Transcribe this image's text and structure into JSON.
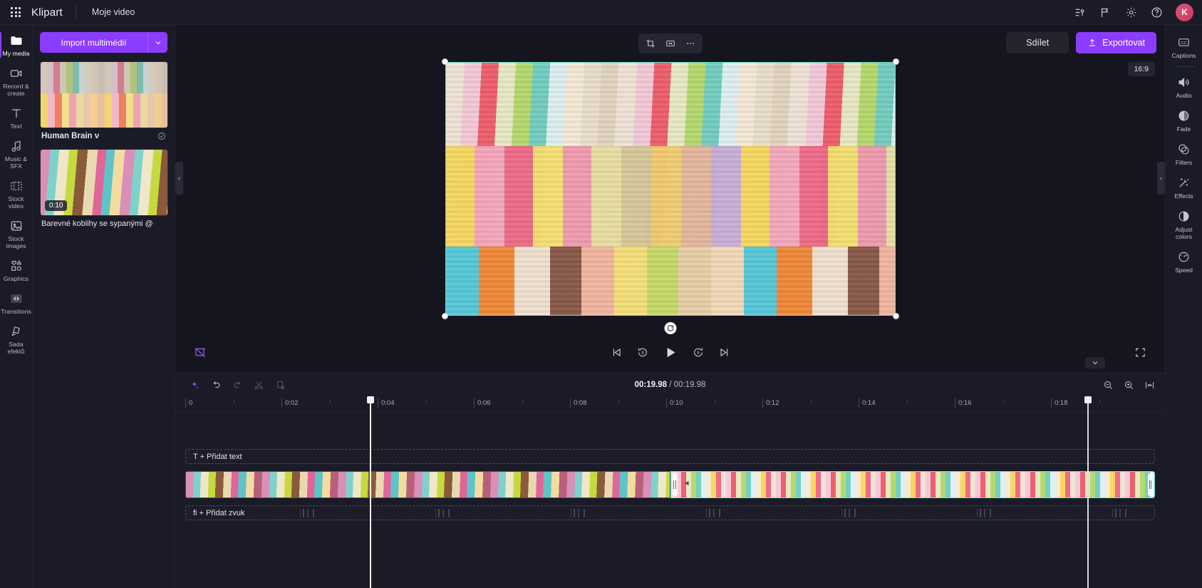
{
  "app": {
    "brand": "Klipart",
    "project_title": "Moje video",
    "accent": "#8b3dff",
    "selection_color": "#5fe3c8",
    "avatar_initial": "K"
  },
  "topbar": {
    "icons": [
      {
        "name": "versions-icon",
        "glyph": "versions"
      },
      {
        "name": "flag-icon",
        "glyph": "flag"
      },
      {
        "name": "settings-icon",
        "glyph": "gear"
      },
      {
        "name": "help-icon",
        "glyph": "question"
      }
    ]
  },
  "left_rail": {
    "items": [
      {
        "label": "My media",
        "icon": "folder-icon",
        "active": true
      },
      {
        "label": "Record & create",
        "icon": "camera-icon",
        "active": false
      },
      {
        "label": "Text",
        "icon": "text-icon",
        "active": false
      },
      {
        "label": "Music & SFX",
        "icon": "music-icon",
        "active": false
      },
      {
        "label": "Stock video",
        "icon": "film-icon",
        "active": false
      },
      {
        "label": "Stock images",
        "icon": "image-icon",
        "active": false
      },
      {
        "label": "Graphics",
        "icon": "shapes-icon",
        "active": false
      },
      {
        "label": "Transitions",
        "icon": "transitions-icon",
        "active": false
      },
      {
        "label": "Sada efektů",
        "icon": "effects-pack-icon",
        "active": false
      }
    ]
  },
  "media_panel": {
    "import_label": "Import multimédií",
    "import_caret": "chevron-down-icon",
    "items": [
      {
        "name": "Human Brain ν",
        "duration": "",
        "thumb": "macaron",
        "bold": true,
        "has_check": true
      },
      {
        "name": "Barevné koblihy se sypanými @",
        "duration": "0:10",
        "thumb": "donut",
        "bold": false,
        "has_check": false
      }
    ]
  },
  "preview": {
    "float_tools": [
      {
        "name": "crop-icon",
        "label": "Crop"
      },
      {
        "name": "fit-icon",
        "label": "Fit"
      },
      {
        "name": "more-icon",
        "label": "More"
      }
    ],
    "share_label": "Sdílet",
    "export_label": "Exportovat",
    "aspect_ratio": "16:9",
    "transport": [
      {
        "name": "skip-back-icon"
      },
      {
        "name": "rewind-5-icon"
      },
      {
        "name": "play-icon"
      },
      {
        "name": "forward-5-icon"
      },
      {
        "name": "skip-forward-icon"
      }
    ],
    "magic_tool": "auto-compose-icon",
    "fullscreen": "fullscreen-icon",
    "rotate_handle": "rotate-icon"
  },
  "timeline": {
    "tools": [
      {
        "name": "ai-magic-icon"
      },
      {
        "name": "undo-icon"
      },
      {
        "name": "redo-icon"
      },
      {
        "name": "split-icon"
      },
      {
        "name": "duplicate-icon"
      }
    ],
    "current_time": "00:19.98",
    "separator": "/",
    "total_time": "00:19.98",
    "zoom_controls": [
      {
        "name": "zoom-out-icon"
      },
      {
        "name": "zoom-in-icon"
      },
      {
        "name": "fit-timeline-icon"
      }
    ],
    "ruler_ticks": [
      "0",
      "0:02",
      "0:04",
      "0:06",
      "0:08",
      "0:10",
      "0:12",
      "0:14",
      "0:16",
      "0:18"
    ],
    "text_track_label": "T + Přidat text",
    "audio_track_label": "fi + Přidat zvuk",
    "clips": [
      {
        "name": "donut-clip",
        "selected": false
      },
      {
        "name": "macaron-clip",
        "selected": true
      }
    ]
  },
  "right_rail": {
    "items": [
      {
        "label": "Captions",
        "icon": "captions-icon",
        "divider_after": true
      },
      {
        "label": "Audio",
        "icon": "speaker-icon",
        "divider_after": false
      },
      {
        "label": "Fade",
        "icon": "fade-icon",
        "divider_after": false
      },
      {
        "label": "Filters",
        "icon": "filters-icon",
        "divider_after": false
      },
      {
        "label": "Effects",
        "icon": "effects-icon",
        "divider_after": false
      },
      {
        "label": "Adjust colors",
        "icon": "adjust-colors-icon",
        "divider_after": false
      },
      {
        "label": "Speed",
        "icon": "speed-icon",
        "divider_after": false
      }
    ]
  }
}
